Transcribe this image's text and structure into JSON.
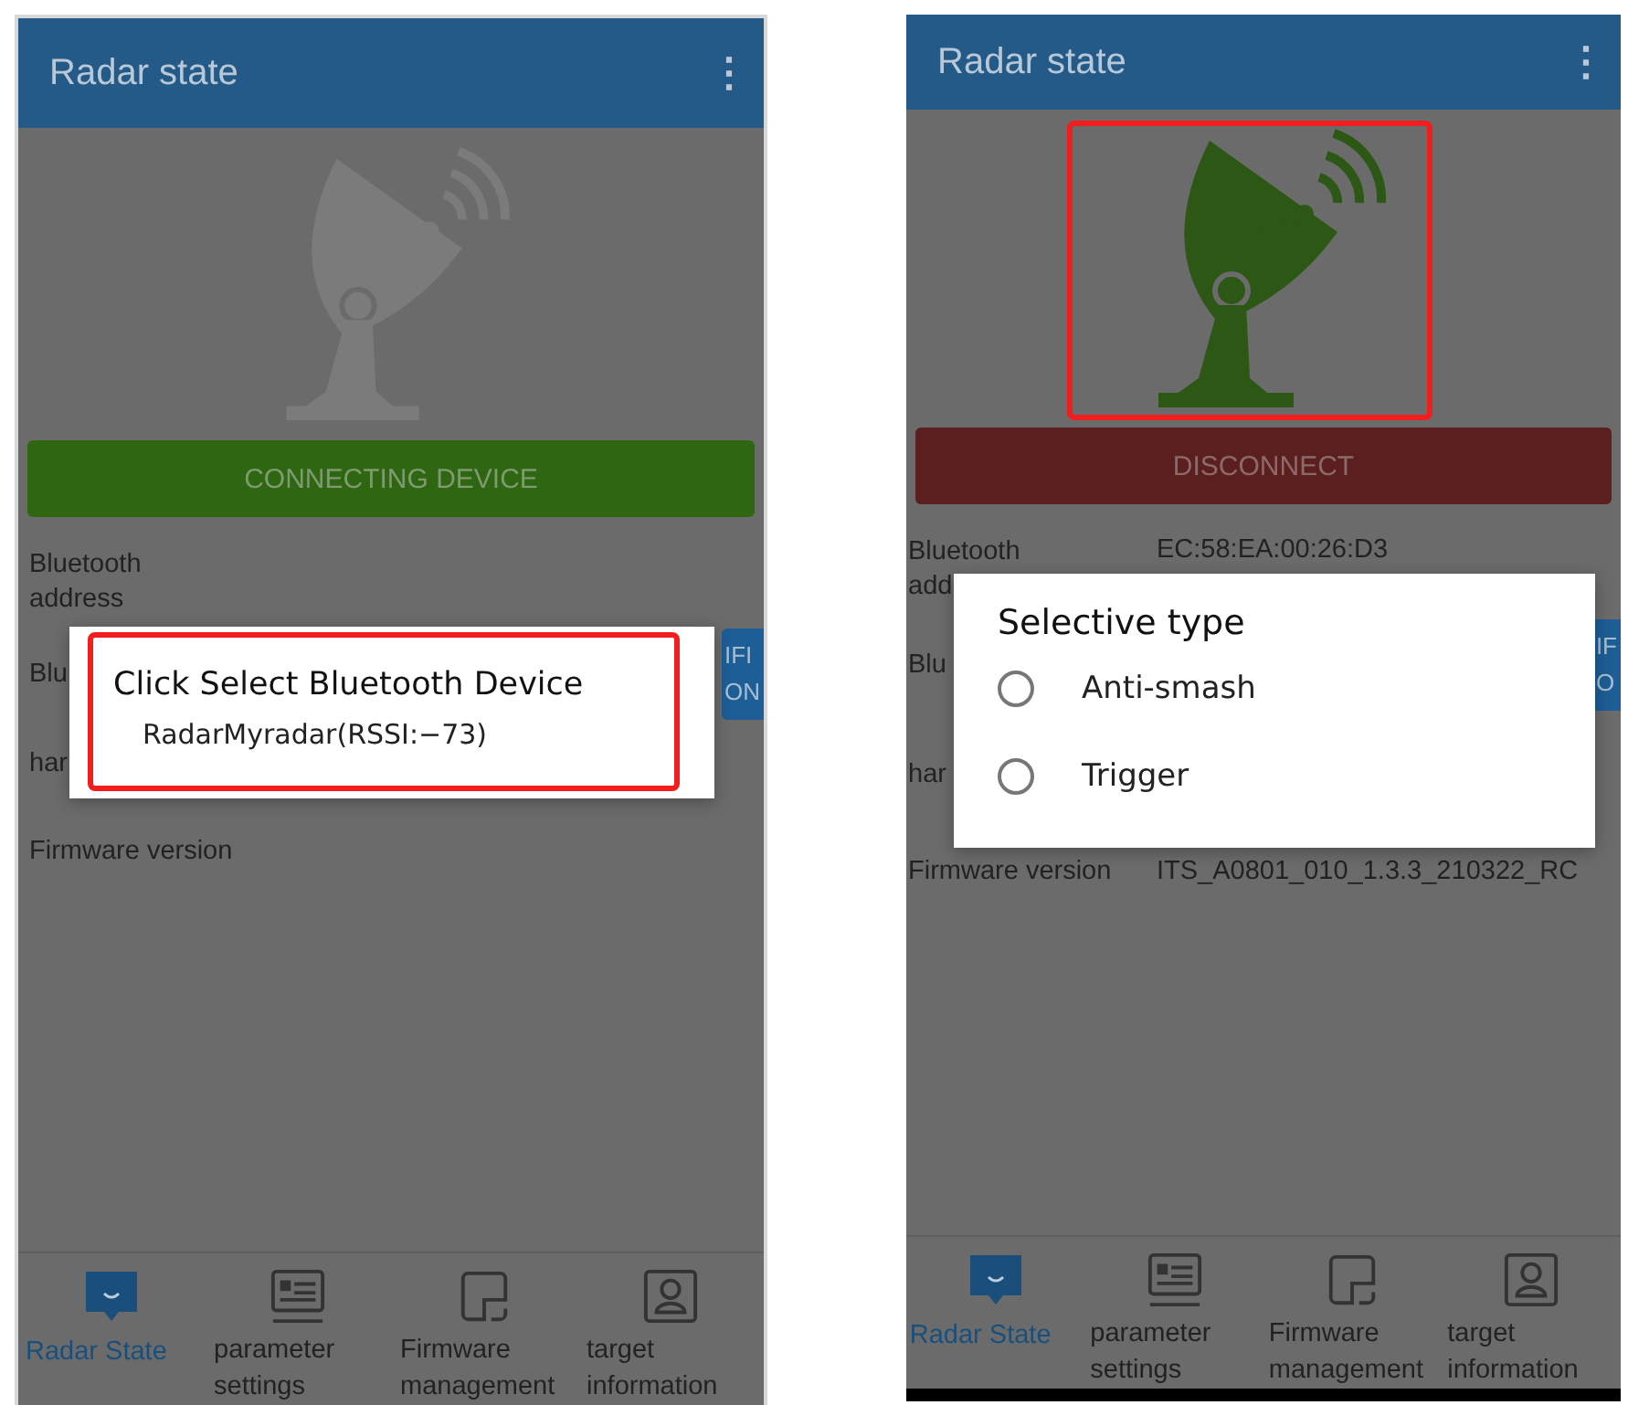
{
  "screens": [
    {
      "app_bar": {
        "title": "Radar state",
        "menu": "⋮"
      },
      "connected": false,
      "action_button": {
        "label": "CONNECTING DEVICE"
      },
      "info_rows": [
        {
          "lines": [
            "Bluetooth",
            "address"
          ]
        },
        {
          "lines": [
            "Blu"
          ],
          "side_button": [
            "IFI",
            "ON"
          ]
        },
        {
          "lines": [
            "har"
          ]
        },
        {
          "lines": [
            "Firmware version"
          ]
        }
      ],
      "dialog": {
        "kind": "list",
        "title": "Click Select Bluetooth Device",
        "items": [
          "RadarMyradar(RSSI:−73)"
        ]
      },
      "nav": [
        {
          "kind": "radar",
          "label": "Radar State",
          "selected": true
        },
        {
          "kind": "params",
          "label": "parameter settings",
          "selected": false
        },
        {
          "kind": "firmware",
          "label": "Firmware management",
          "selected": false
        },
        {
          "kind": "target",
          "label": "target information",
          "selected": false
        }
      ]
    },
    {
      "app_bar": {
        "title": "Radar state",
        "menu": "⋮"
      },
      "connected": true,
      "action_button": {
        "label": "DISCONNECT"
      },
      "info_rows": [
        {
          "lines": [
            "Bluetooth",
            "add"
          ],
          "value": "EC:58:EA:00:26:D3"
        },
        {
          "lines": [
            "Blu"
          ],
          "side_button": [
            "IF",
            "O"
          ]
        },
        {
          "lines": [
            "har"
          ]
        },
        {
          "lines": [
            "Firmware version"
          ],
          "value": "ITS_A0801_010_1.3.3_210322_RC"
        }
      ],
      "dialog": {
        "kind": "radio",
        "title": "Selective type",
        "options": [
          {
            "label": "Anti-smash",
            "selected": false
          },
          {
            "label": "Trigger",
            "selected": false
          }
        ]
      },
      "nav": [
        {
          "kind": "radar",
          "label": "Radar State",
          "selected": true
        },
        {
          "kind": "params",
          "label": "parameter settings",
          "selected": false
        },
        {
          "kind": "firmware",
          "label": "Firmware management",
          "selected": false
        },
        {
          "kind": "target",
          "label": "target information",
          "selected": false
        }
      ]
    }
  ]
}
